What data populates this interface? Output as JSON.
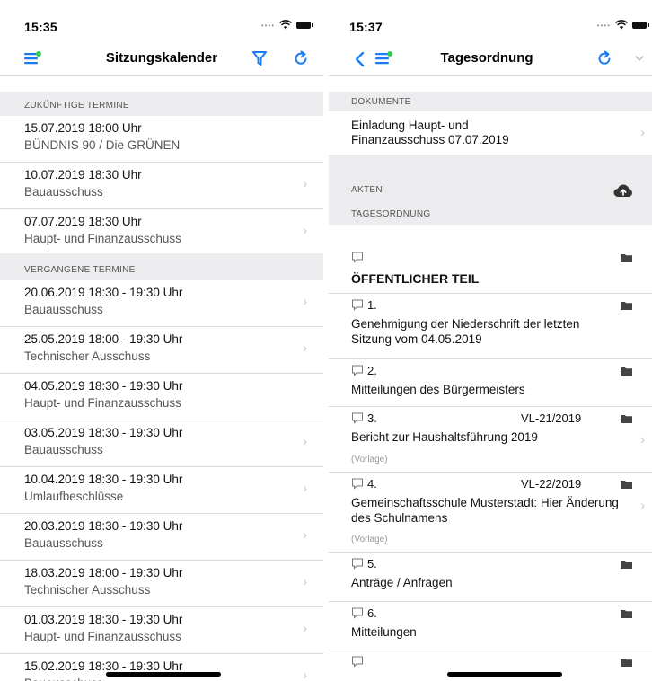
{
  "left": {
    "time": "15:35",
    "title": "Sitzungskalender",
    "future_header": "ZUKÜNFTIGE TERMINE",
    "past_header": "VERGANGENE TERMINE",
    "future": [
      {
        "date": "15.07.2019 18:00 Uhr",
        "committee": "BÜNDNIS 90 / Die GRÜNEN",
        "chevron": false
      },
      {
        "date": "10.07.2019 18:30 Uhr",
        "committee": "Bauausschuss",
        "chevron": true
      },
      {
        "date": "07.07.2019 18:30 Uhr",
        "committee": "Haupt- und Finanzausschuss",
        "chevron": true
      }
    ],
    "past": [
      {
        "date": "20.06.2019 18:30 -  19:30 Uhr",
        "committee": "Bauausschuss",
        "chevron": true
      },
      {
        "date": "25.05.2019 18:00 -  19:30 Uhr",
        "committee": "Technischer Ausschuss",
        "chevron": true
      },
      {
        "date": "04.05.2019 18:30 -  19:30 Uhr",
        "committee": "Haupt- und Finanzausschuss",
        "chevron": false
      },
      {
        "date": "03.05.2019 18:30 -  19:30 Uhr",
        "committee": "Bauausschuss",
        "chevron": true
      },
      {
        "date": "10.04.2019 18:30 -  19:30 Uhr",
        "committee": "Umlaufbeschlüsse",
        "chevron": true
      },
      {
        "date": "20.03.2019 18:30 -  19:30 Uhr",
        "committee": "Bauausschuss",
        "chevron": true
      },
      {
        "date": "18.03.2019 18:00 -  19:30 Uhr",
        "committee": "Technischer Ausschuss",
        "chevron": true
      },
      {
        "date": "01.03.2019 18:30 -  19:30 Uhr",
        "committee": "Haupt- und Finanzausschuss",
        "chevron": true
      },
      {
        "date": "15.02.2019 18:30 -  19:30 Uhr",
        "committee": "Bauausschuss",
        "chevron": true
      }
    ]
  },
  "right": {
    "time": "15:37",
    "title": "Tagesordnung",
    "docs_header": "DOKUMENTE",
    "doc_title": "Einladung Haupt- und Finanzausschuss 07.07.2019",
    "akten_header": "AKTEN",
    "agenda_header": "TAGESORDNUNG",
    "agenda": [
      {
        "num": "",
        "ref": "",
        "text": "ÖFFENTLICHER TEIL",
        "sub": "",
        "bold": true,
        "chevron": false
      },
      {
        "num": "1.",
        "ref": "",
        "text": "Genehmigung der Niederschrift der letzten Sitzung vom 04.05.2019",
        "sub": "",
        "bold": false,
        "chevron": false
      },
      {
        "num": "2.",
        "ref": "",
        "text": "Mitteilungen des Bürgermeisters",
        "sub": "",
        "bold": false,
        "chevron": false
      },
      {
        "num": "3.",
        "ref": "VL-21/2019",
        "text": "Bericht zur Haushaltsführung 2019",
        "sub": "(Vorlage)",
        "bold": false,
        "chevron": true
      },
      {
        "num": "4.",
        "ref": "VL-22/2019",
        "text": "Gemeinschaftsschule Musterstadt: Hier Änderung des Schulnamens",
        "sub": "(Vorlage)",
        "bold": false,
        "chevron": true
      },
      {
        "num": "5.",
        "ref": "",
        "text": "Anträge / Anfragen",
        "sub": "",
        "bold": false,
        "chevron": false
      },
      {
        "num": "6.",
        "ref": "",
        "text": "Mitteilungen",
        "sub": "",
        "bold": false,
        "chevron": false
      },
      {
        "num": "",
        "ref": "",
        "text": "",
        "sub": "",
        "bold": false,
        "chevron": false
      }
    ]
  },
  "colors": {
    "accent": "#1a7cf5",
    "menu_dot": "#33cc55",
    "section_bg": "#ececee",
    "folder": "#444444"
  },
  "icons": [
    "menu-icon",
    "filter-icon",
    "refresh-icon",
    "back-chevron-icon",
    "cloud-upload-icon",
    "folder-icon",
    "comment-bubble-icon",
    "chevron-right-icon",
    "chevron-down-icon",
    "wifi-icon",
    "battery-icon"
  ]
}
